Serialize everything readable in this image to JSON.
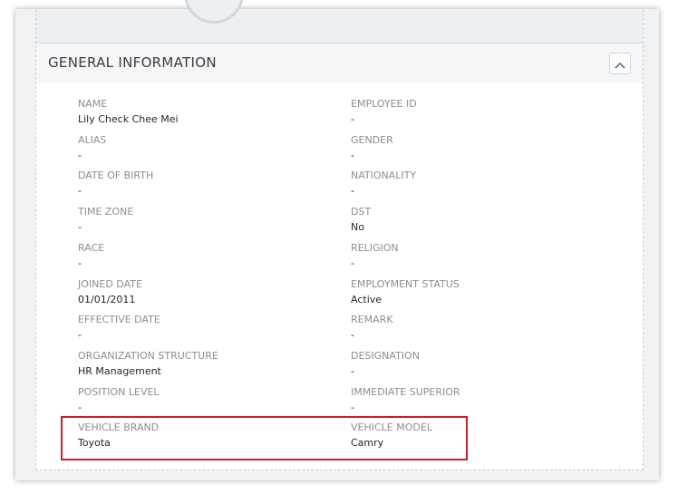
{
  "section": {
    "title": "GENERAL INFORMATION"
  },
  "icons": {
    "collapse": "chevron-up-icon"
  },
  "colors": {
    "highlight": "#cc1f2b"
  },
  "fields": [
    {
      "label": "NAME",
      "value": "Lily Check Chee Mei"
    },
    {
      "label": "EMPLOYEE ID",
      "value": "-"
    },
    {
      "label": "ALIAS",
      "value": "-"
    },
    {
      "label": "GENDER",
      "value": "-"
    },
    {
      "label": "DATE OF BIRTH",
      "value": "-"
    },
    {
      "label": "NATIONALITY",
      "value": "-"
    },
    {
      "label": "TIME ZONE",
      "value": "-"
    },
    {
      "label": "DST",
      "value": "No"
    },
    {
      "label": "RACE",
      "value": "-"
    },
    {
      "label": "RELIGION",
      "value": "-"
    },
    {
      "label": "JOINED DATE",
      "value": "01/01/2011"
    },
    {
      "label": "EMPLOYMENT STATUS",
      "value": "Active"
    },
    {
      "label": "EFFECTIVE DATE",
      "value": "-"
    },
    {
      "label": "REMARK",
      "value": "-"
    },
    {
      "label": "ORGANIZATION STRUCTURE",
      "value": "HR Management"
    },
    {
      "label": "DESIGNATION",
      "value": "-"
    },
    {
      "label": "POSITION LEVEL",
      "value": "-"
    },
    {
      "label": "IMMEDIATE SUPERIOR",
      "value": "-"
    },
    {
      "label": "VEHICLE BRAND",
      "value": "Toyota"
    },
    {
      "label": "VEHICLE MODEL",
      "value": "Camry"
    }
  ]
}
